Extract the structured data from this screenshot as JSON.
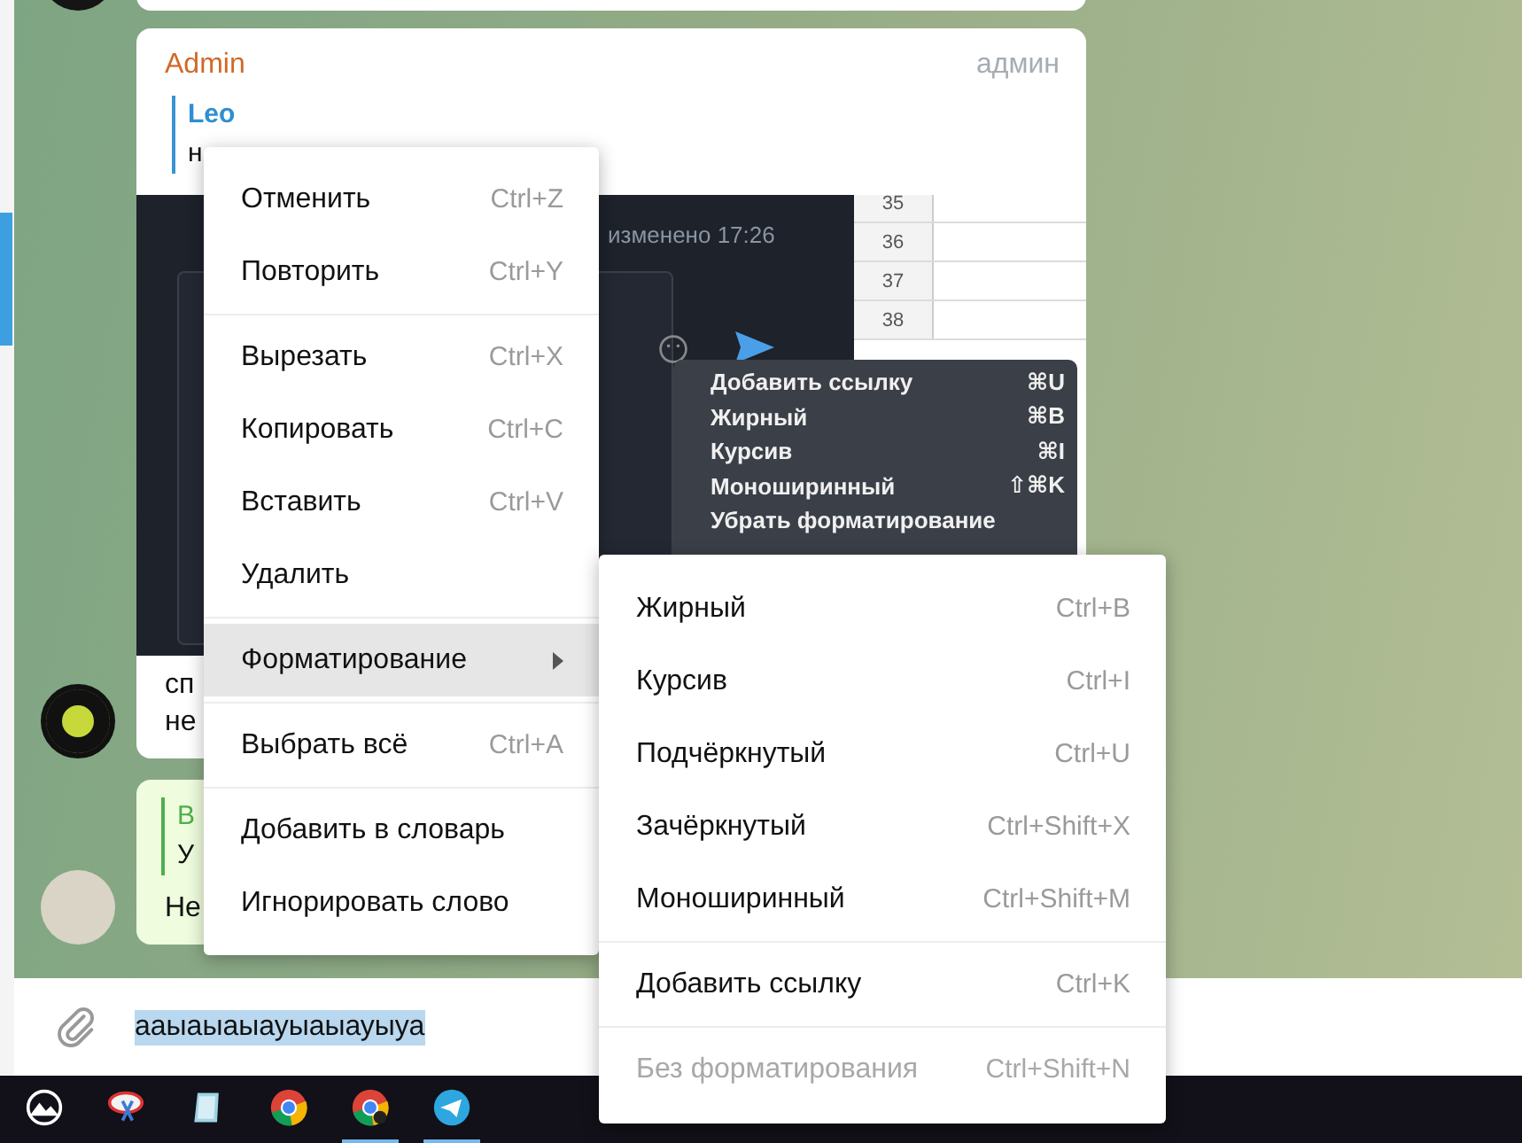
{
  "chat": {
    "messages": [
      {
        "kind": "cut"
      },
      {
        "kind": "post",
        "sender": "Admin",
        "badge": "админ",
        "reply": {
          "name": "Leo",
          "text": "н"
        },
        "screenshot": {
          "status": "изменено 17:26",
          "row_numbers": [
            "35",
            "36",
            "37",
            "38"
          ],
          "menu": [
            {
              "label": "Добавить ссылку",
              "shortcut": "⌘U"
            },
            {
              "label": "Жирный",
              "shortcut": "⌘B"
            },
            {
              "label": "Курсив",
              "shortcut": "⌘I"
            },
            {
              "label": "Моноширинный",
              "shortcut": "⇧⌘K"
            },
            {
              "label": "Убрать форматирование"
            }
          ]
        },
        "lines": [
          "сп",
          "не"
        ]
      },
      {
        "kind": "reply",
        "reply": {
          "name": "В",
          "text": "У"
        },
        "lines": [
          "Не"
        ]
      }
    ]
  },
  "input": {
    "value": "ааыаыаыауыаыауыуа",
    "selected": true
  },
  "context_menu": {
    "items": [
      {
        "kind": "item",
        "label": "Отменить",
        "shortcut": "Ctrl+Z",
        "selected": false
      },
      {
        "kind": "item",
        "label": "Повторить",
        "shortcut": "Ctrl+Y",
        "selected": false
      },
      {
        "kind": "separator"
      },
      {
        "kind": "item",
        "label": "Вырезать",
        "shortcut": "Ctrl+X",
        "selected": false
      },
      {
        "kind": "item",
        "label": "Копировать",
        "shortcut": "Ctrl+C",
        "selected": false
      },
      {
        "kind": "item",
        "label": "Вставить",
        "shortcut": "Ctrl+V",
        "selected": false
      },
      {
        "kind": "item",
        "label": "Удалить",
        "selected": false
      },
      {
        "kind": "separator"
      },
      {
        "kind": "submenu",
        "label": "Форматирование",
        "selected": true
      },
      {
        "kind": "separator"
      },
      {
        "kind": "item",
        "label": "Выбрать всё",
        "shortcut": "Ctrl+A",
        "selected": false
      },
      {
        "kind": "separator"
      },
      {
        "kind": "item",
        "label": "Добавить в словарь",
        "selected": false
      },
      {
        "kind": "item",
        "label": "Игнорировать слово",
        "selected": false
      }
    ]
  },
  "submenu": {
    "items": [
      {
        "kind": "item",
        "label": "Жирный",
        "shortcut": "Ctrl+B",
        "disabled": false
      },
      {
        "kind": "item",
        "label": "Курсив",
        "shortcut": "Ctrl+I",
        "disabled": false
      },
      {
        "kind": "item",
        "label": "Подчёркнутый",
        "shortcut": "Ctrl+U",
        "disabled": false
      },
      {
        "kind": "item",
        "label": "Зачёркнутый",
        "shortcut": "Ctrl+Shift+X",
        "disabled": false
      },
      {
        "kind": "item",
        "label": "Моноширинный",
        "shortcut": "Ctrl+Shift+M",
        "disabled": false
      },
      {
        "kind": "separator"
      },
      {
        "kind": "item",
        "label": "Добавить ссылку",
        "shortcut": "Ctrl+K",
        "disabled": false
      },
      {
        "kind": "separator"
      },
      {
        "kind": "item",
        "label": "Без форматирования",
        "shortcut": "Ctrl+Shift+N",
        "disabled": true
      }
    ]
  },
  "taskbar": {
    "items": [
      {
        "kind": "photos",
        "active": false
      },
      {
        "kind": "snipping",
        "active": false
      },
      {
        "kind": "notepad",
        "active": false
      },
      {
        "kind": "browser",
        "active": false
      },
      {
        "kind": "browser-profile",
        "active": true
      },
      {
        "kind": "messenger",
        "active": true
      }
    ]
  }
}
